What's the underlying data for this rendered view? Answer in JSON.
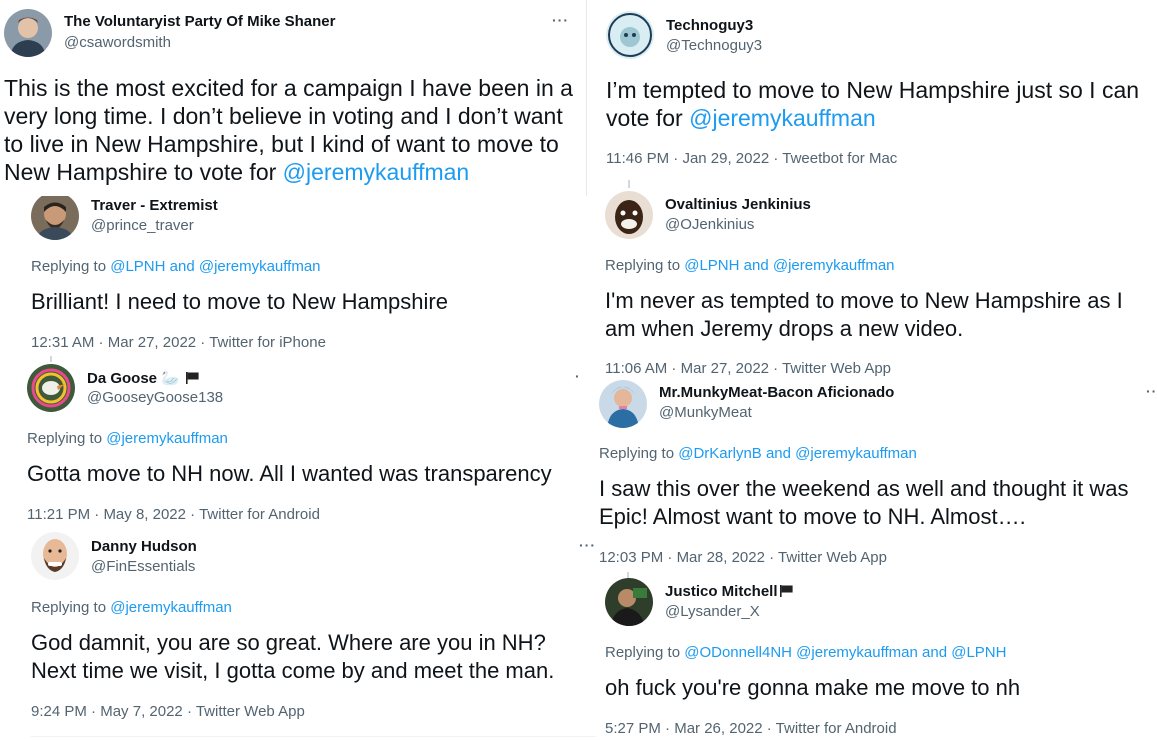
{
  "tweets": [
    {
      "name": "The Voluntaryist Party Of Mike Shaner",
      "handle": "@csawordsmith",
      "more": "···",
      "text_lines": [
        "This is the most excited for a campaign I have been in a",
        "very long time. I don’t believe in voting and I don’t want",
        "to live in New Hampshire, but I kind of want to move to",
        "New Hampshire to vote for "
      ],
      "mention": "@jeremykauffman"
    },
    {
      "name": "Technoguy3",
      "handle": "@Technoguy3",
      "text_line1": "I’m tempted to move to New Hampshire just so I can",
      "text_line2": "vote for ",
      "mention": "@jeremykauffman",
      "time": "11:46 PM",
      "date": "Jan 29, 2022",
      "source": "Tweetbot for Mac"
    },
    {
      "name": "Traver - Extremist",
      "handle": "@prince_traver",
      "replying": "Replying to ",
      "mention1": "@LPNH",
      "and": " and ",
      "mention2": "@jeremykauffman",
      "text": "Brilliant! I need to move to New Hampshire",
      "time": "12:31 AM",
      "date": "Mar 27, 2022",
      "source": "Twitter for iPhone"
    },
    {
      "name": "Ovaltinius Jenkinius",
      "handle": "@OJenkinius",
      "replying": "Replying to ",
      "mention1": "@LPNH",
      "and": " and ",
      "mention2": "@jeremykauffman",
      "text_line1": "I'm never as tempted to move to New Hampshire as I",
      "text_line2": "am when Jeremy drops a new video.",
      "time": "11:06 AM",
      "date": "Mar 27, 2022",
      "source": "Twitter Web App"
    },
    {
      "name": "Da Goose",
      "emoji": "🦢",
      "handle": "@GooseyGoose138",
      "replying": "Replying to ",
      "mention": "@jeremykauffman",
      "text": "Gotta move to NH now. All I wanted was transparency",
      "time": "11:21 PM",
      "date": "May 8, 2022",
      "source": "Twitter for Android"
    },
    {
      "name": "Mr.MunkyMeat-Bacon Aficionado",
      "handle": "@MunkyMeat",
      "more": "··",
      "replying": "Replying to ",
      "mention1": "@DrKarlynB",
      "and": " and ",
      "mention2": "@jeremykauffman",
      "text_line1": "I saw this over the weekend as well and thought it was",
      "text_line2": "Epic! Almost want to move to NH. Almost….",
      "time": "12:03 PM",
      "date": "Mar 28, 2022",
      "source": "Twitter Web App"
    },
    {
      "name": "Danny Hudson",
      "handle": "@FinEssentials",
      "more": "···",
      "replying": "Replying to ",
      "mention": "@jeremykauffman",
      "text_line1": "God damnit, you are so great. Where are you in NH?",
      "text_line2": "Next time we visit, I gotta come by and meet the man.",
      "time": "9:24 PM",
      "date": "May 7, 2022",
      "source": "Twitter Web App"
    },
    {
      "name": "Justico Mitchell",
      "handle": "@Lysander_X",
      "replying": "Replying to ",
      "mention1": "@ODonnell4NH",
      "space": " ",
      "mention2": "@jeremykauffman",
      "and": " and ",
      "mention3": "@LPNH",
      "text": "oh fuck you're gonna make me move to nh",
      "time": "5:27 PM",
      "date": "Mar 26, 2022",
      "source": "Twitter for Android"
    }
  ],
  "sep": " · ",
  "colors": {
    "link": "#1d9bf0",
    "muted": "#536471",
    "text": "#0f1419",
    "line": "#cfd9de"
  },
  "icons": {
    "more": "more-horizontal-icon",
    "flag": "black-flag-icon"
  }
}
